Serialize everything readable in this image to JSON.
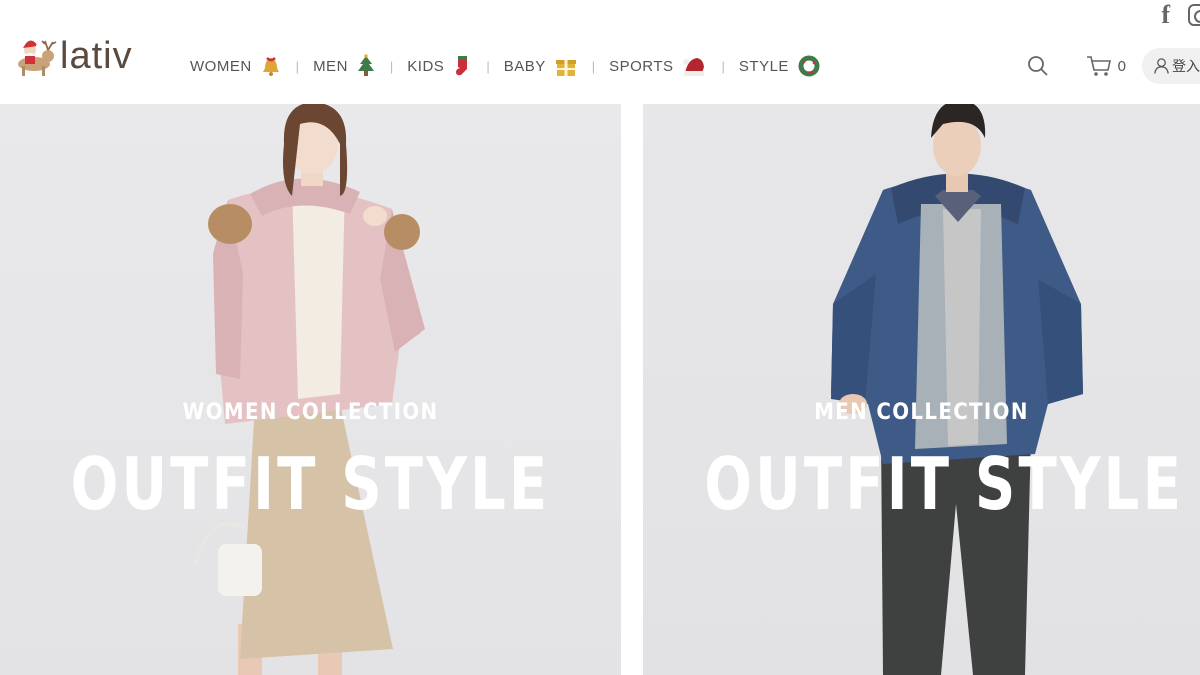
{
  "brand": {
    "name": "lativ"
  },
  "social": {
    "facebook_label": "f"
  },
  "nav": {
    "items": [
      {
        "label": "WOMEN",
        "icon": "bell-icon"
      },
      {
        "label": "MEN",
        "icon": "christmas-tree-icon"
      },
      {
        "label": "KIDS",
        "icon": "stocking-icon"
      },
      {
        "label": "BABY",
        "icon": "gift-icon"
      },
      {
        "label": "SPORTS",
        "icon": "santa-hat-icon"
      },
      {
        "label": "STYLE",
        "icon": "wreath-icon"
      }
    ],
    "separator": "|"
  },
  "tools": {
    "cart_count": "0",
    "login_label": "登入"
  },
  "banners": [
    {
      "subtitle": "WOMEN COLLECTION",
      "title": "OUTFIT STYLE"
    },
    {
      "subtitle": "MEN COLLECTION",
      "title": "OUTFIT STYLE"
    }
  ],
  "colors": {
    "text": "#555555",
    "logo": "#5a4a3f",
    "banner_bg": "#e6e6e8",
    "overlay_text": "#ffffff"
  }
}
